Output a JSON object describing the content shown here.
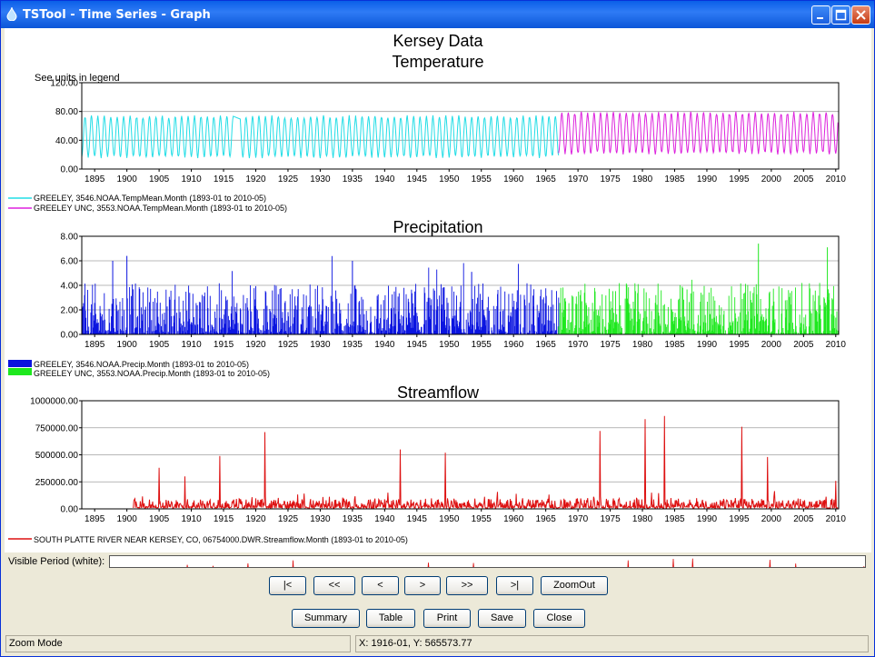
{
  "window": {
    "title": "TSTool - Time Series - Graph"
  },
  "graph": {
    "title": "Kersey Data",
    "units_note": "See units in legend",
    "x_tick_labels": [
      "1895",
      "1900",
      "1905",
      "1910",
      "1915",
      "1920",
      "1925",
      "1930",
      "1935",
      "1940",
      "1945",
      "1950",
      "1955",
      "1960",
      "1965",
      "1970",
      "1975",
      "1980",
      "1985",
      "1990",
      "1995",
      "2000",
      "2005",
      "2010"
    ]
  },
  "chart_data": [
    {
      "type": "line",
      "title": "Temperature",
      "ylabel": "See units in legend",
      "ylim": [
        0,
        120
      ],
      "y_tick_labels": [
        "0.00",
        "40.00",
        "80.00",
        "120.00"
      ],
      "x_range": [
        "1893-01",
        "2010-05"
      ],
      "grid": true,
      "legend_placement": "below",
      "series": [
        {
          "name": "GREELEY, 3546.NOAA.TempMean.Month (1893-01 to 2010-05)",
          "color": "#22dde6",
          "period": [
            "1893-01",
            "1967-01"
          ],
          "range_approx": [
            15,
            75
          ]
        },
        {
          "name": "GREELEY UNC, 3553.NOAA.TempMean.Month (1893-01 to 2010-05)",
          "color": "#dd22dd",
          "period": [
            "1967-01",
            "2010-05"
          ],
          "range_approx": [
            20,
            80
          ]
        }
      ]
    },
    {
      "type": "bar",
      "title": "Precipitation",
      "ylim": [
        0,
        8
      ],
      "y_tick_labels": [
        "0.00",
        "2.00",
        "4.00",
        "6.00",
        "8.00"
      ],
      "x_range": [
        "1893-01",
        "2010-05"
      ],
      "grid": true,
      "legend_placement": "below",
      "series": [
        {
          "name": "GREELEY, 3546.NOAA.Precip.Month (1893-01 to 2010-05)",
          "color": "#0a14e0",
          "period": [
            "1893-01",
            "1967-01"
          ]
        },
        {
          "name": "GREELEY UNC, 3553.NOAA.Precip.Month (1893-01 to 2010-05)",
          "color": "#1ee81e",
          "period": [
            "1967-01",
            "2010-05"
          ]
        }
      ],
      "peaks": [
        {
          "x": 1900.0,
          "y": 6.4
        },
        {
          "x": 1897.8,
          "y": 6.0
        },
        {
          "x": 1935.0,
          "y": 6.0
        },
        {
          "x": 1953.5,
          "y": 5.1
        },
        {
          "x": 1998.0,
          "y": 7.4
        },
        {
          "x": 2008.7,
          "y": 7.1
        }
      ]
    },
    {
      "type": "line",
      "title": "Streamflow",
      "ylim": [
        0,
        1000000
      ],
      "y_tick_labels": [
        "0.00",
        "250000.00",
        "500000.00",
        "750000.00",
        "1000000.00"
      ],
      "x_range": [
        "1893-01",
        "2010-05"
      ],
      "grid": true,
      "legend_placement": "below",
      "series": [
        {
          "name": "SOUTH PLATTE RIVER NEAR KERSEY, CO, 06754000.DWR.Streamflow.Month (1893-01 to 2010-05)",
          "color": "#dd1111",
          "period": [
            "1901-01",
            "2010-05"
          ]
        }
      ],
      "peaks": [
        {
          "x": 1905.0,
          "y": 380000
        },
        {
          "x": 1909.0,
          "y": 300000
        },
        {
          "x": 1914.4,
          "y": 490000
        },
        {
          "x": 1921.4,
          "y": 710000
        },
        {
          "x": 1942.4,
          "y": 550000
        },
        {
          "x": 1949.4,
          "y": 520000
        },
        {
          "x": 1973.4,
          "y": 720000
        },
        {
          "x": 1980.4,
          "y": 830000
        },
        {
          "x": 1983.4,
          "y": 860000
        },
        {
          "x": 1995.4,
          "y": 760000
        },
        {
          "x": 1999.4,
          "y": 480000
        },
        {
          "x": 2010.0,
          "y": 260000
        }
      ]
    }
  ],
  "visible_period": {
    "label": "Visible Period (white):"
  },
  "nav_buttons": {
    "first": "|<",
    "prev_page": "<<",
    "prev": "<",
    "next": ">",
    "next_page": ">>",
    "last": ">|",
    "zoom_out": "ZoomOut"
  },
  "action_buttons": {
    "summary": "Summary",
    "table": "Table",
    "print": "Print",
    "save": "Save",
    "close": "Close"
  },
  "status": {
    "mode": "Zoom Mode",
    "coords": "X:  1916-01,  Y:   565573.77"
  }
}
